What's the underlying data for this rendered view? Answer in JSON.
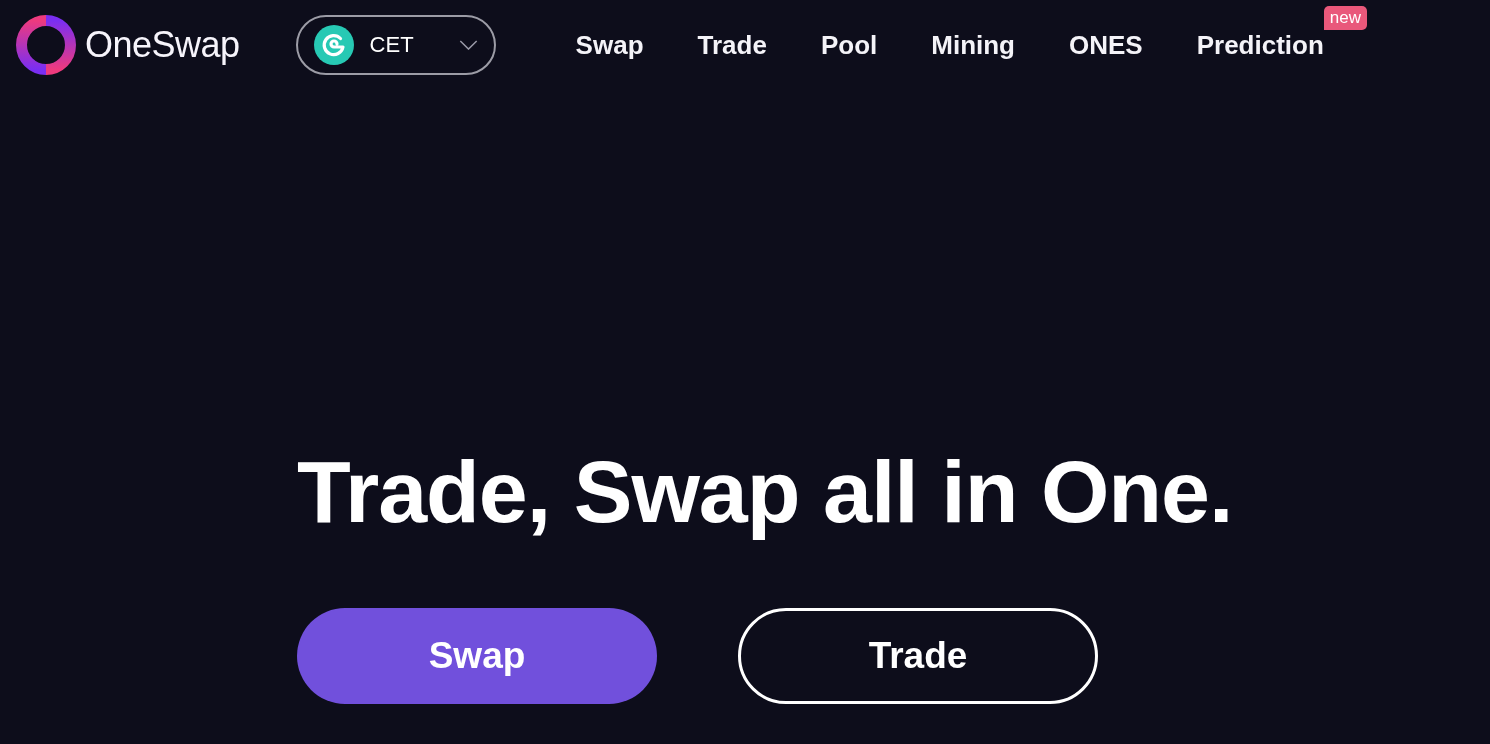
{
  "header": {
    "logo": {
      "name": "OneSwap"
    },
    "token_selector": {
      "value": "CET"
    },
    "nav": [
      {
        "label": "Swap"
      },
      {
        "label": "Trade"
      },
      {
        "label": "Pool"
      },
      {
        "label": "Mining"
      },
      {
        "label": "ONES"
      },
      {
        "label": "Prediction",
        "badge": "new"
      }
    ]
  },
  "hero": {
    "headline": "Trade, Swap all in One.",
    "buttons": [
      {
        "label": "Swap",
        "kind": "primary"
      },
      {
        "label": "Trade",
        "kind": "outline"
      }
    ]
  }
}
